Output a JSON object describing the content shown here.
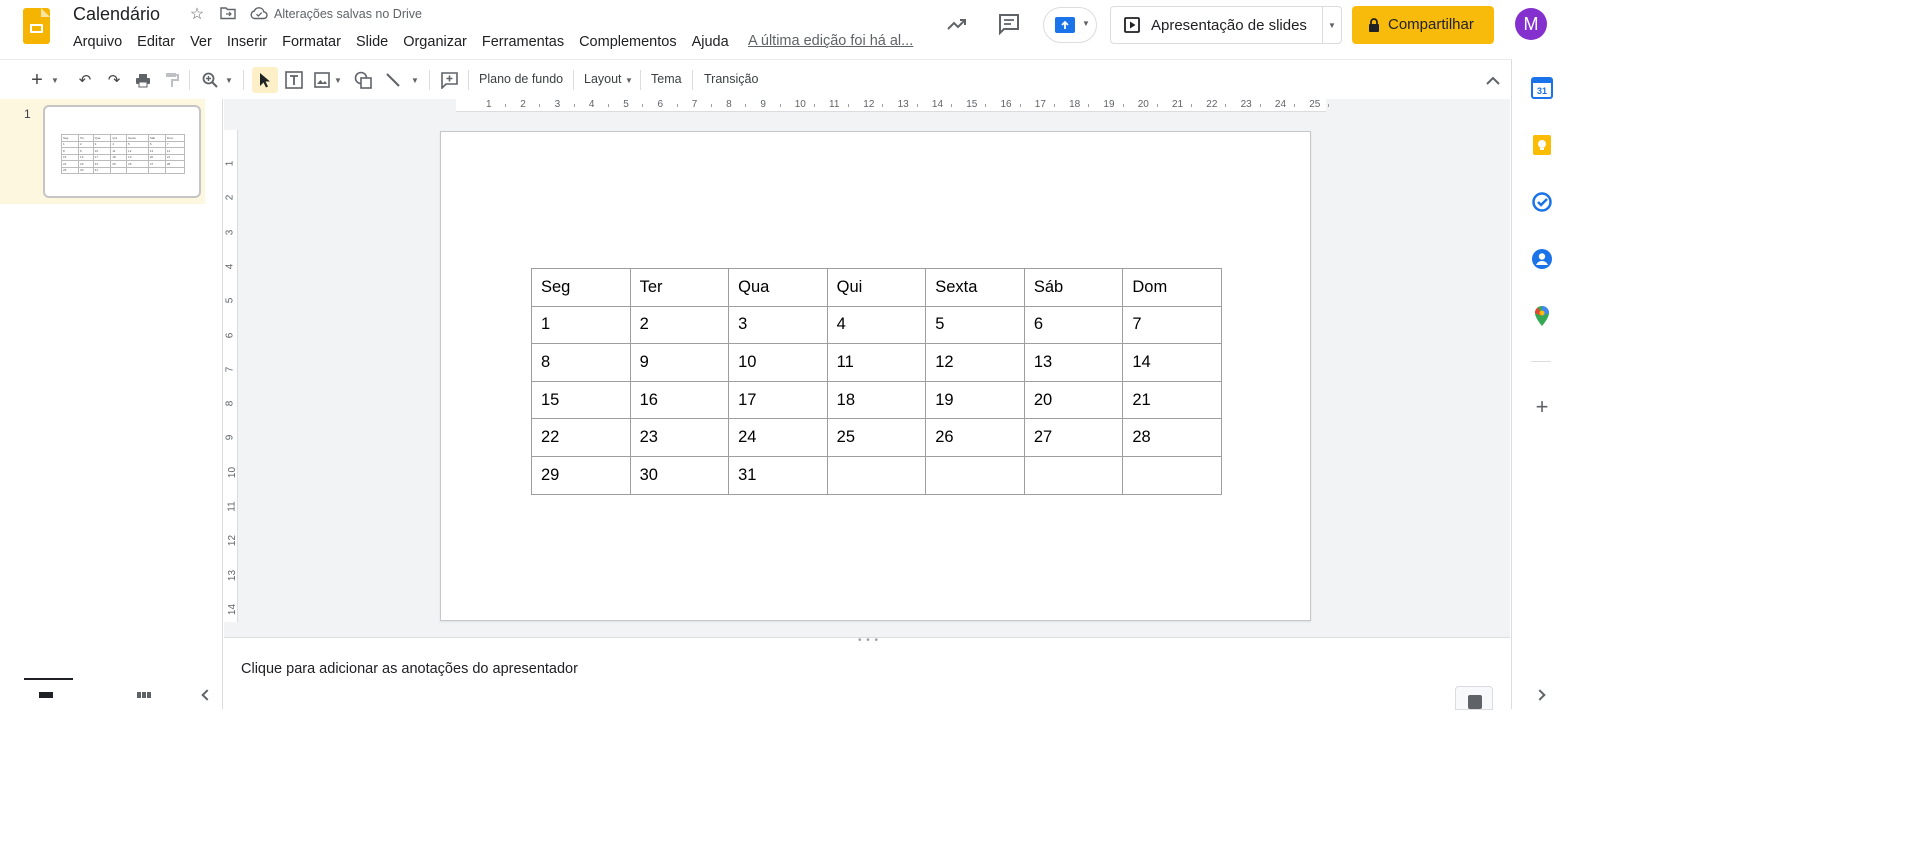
{
  "header": {
    "doc_title": "Calendário",
    "save_status": "Alterações salvas no Drive",
    "last_edit": "A última edição foi há al...",
    "present_label": "Apresentação de slides",
    "share_label": "Compartilhar",
    "avatar_initial": "M"
  },
  "menu": [
    "Arquivo",
    "Editar",
    "Ver",
    "Inserir",
    "Formatar",
    "Slide",
    "Organizar",
    "Ferramentas",
    "Complementos",
    "Ajuda"
  ],
  "toolbar": {
    "background": "Plano de fundo",
    "layout": "Layout",
    "theme": "Tema",
    "transition": "Transição"
  },
  "filmstrip": {
    "slide_number": "1"
  },
  "ruler": {
    "h_labels": [
      "1",
      "2",
      "3",
      "4",
      "5",
      "6",
      "7",
      "8",
      "9",
      "10",
      "11",
      "12",
      "13",
      "14",
      "15",
      "16",
      "17",
      "18",
      "19",
      "20",
      "21",
      "22",
      "23",
      "24",
      "25"
    ],
    "v_labels": [
      "1",
      "2",
      "3",
      "4",
      "5",
      "6",
      "7",
      "8",
      "9",
      "10",
      "11",
      "12",
      "13",
      "14"
    ]
  },
  "calendar": {
    "headers": [
      "Seg",
      "Ter",
      "Qua",
      "Qui",
      "Sexta",
      "Sáb",
      "Dom"
    ],
    "rows": [
      [
        "1",
        "2",
        "3",
        "4",
        "5",
        "6",
        "7"
      ],
      [
        "8",
        "9",
        "10",
        "11",
        "12",
        "13",
        "14"
      ],
      [
        "15",
        "16",
        "17",
        "18",
        "19",
        "20",
        "21"
      ],
      [
        "22",
        "23",
        "24",
        "25",
        "26",
        "27",
        "28"
      ],
      [
        "29",
        "30",
        "31",
        "",
        "",
        "",
        ""
      ]
    ]
  },
  "notes": {
    "placeholder": "Clique para adicionar as anotações do apresentador"
  },
  "colors": {
    "brand_yellow": "#f4b400",
    "share_yellow": "#f9bb0b",
    "avatar_purple": "#8430ce",
    "present_blue": "#1a73e8"
  }
}
